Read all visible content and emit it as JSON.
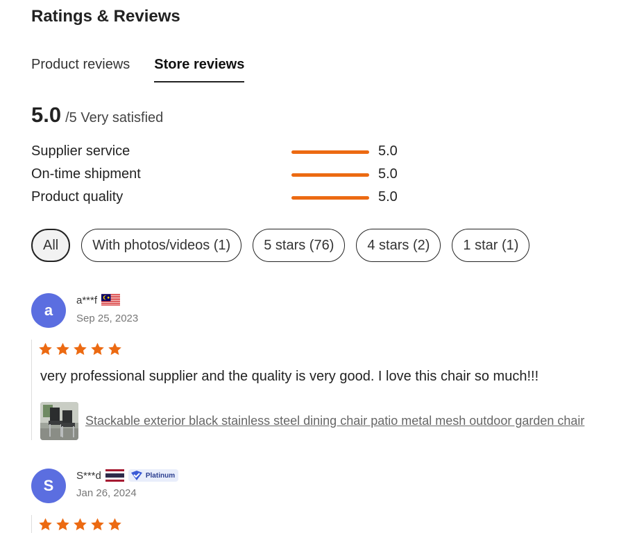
{
  "header": {
    "title": "Ratings & Reviews"
  },
  "tabs": [
    {
      "label": "Product reviews"
    },
    {
      "label": "Store reviews"
    }
  ],
  "summary": {
    "score": "5.0",
    "suffix": "/5 Very satisfied"
  },
  "metrics": [
    {
      "label": "Supplier service",
      "value": "5.0",
      "level": 1.0
    },
    {
      "label": "On-time shipment",
      "value": "5.0",
      "level": 1.0
    },
    {
      "label": "Product quality",
      "value": "5.0",
      "level": 1.0
    }
  ],
  "filters": [
    {
      "label": "All"
    },
    {
      "label": "With photos/videos (1)"
    },
    {
      "label": "5 stars (76)"
    },
    {
      "label": "4 stars (2)"
    },
    {
      "label": "1 star (1)"
    }
  ],
  "reviews": [
    {
      "avatar": "a",
      "name": "a***f",
      "flag": "malaysia-flag-icon",
      "date": "Sep 25, 2023",
      "rating": 5,
      "text": "very professional supplier and the quality is very good. I love this chair so much!!!",
      "product_link": "Stackable exterior black stainless steel dining chair patio metal mesh outdoor garden chair"
    },
    {
      "avatar": "S",
      "name": "S***d",
      "flag": "thailand-flag-icon",
      "badge": "Platinum",
      "date": "Jan 26, 2024",
      "rating": 5
    }
  ],
  "colors": {
    "accent": "#ec6a12",
    "avatar": "#5b6ee0"
  }
}
